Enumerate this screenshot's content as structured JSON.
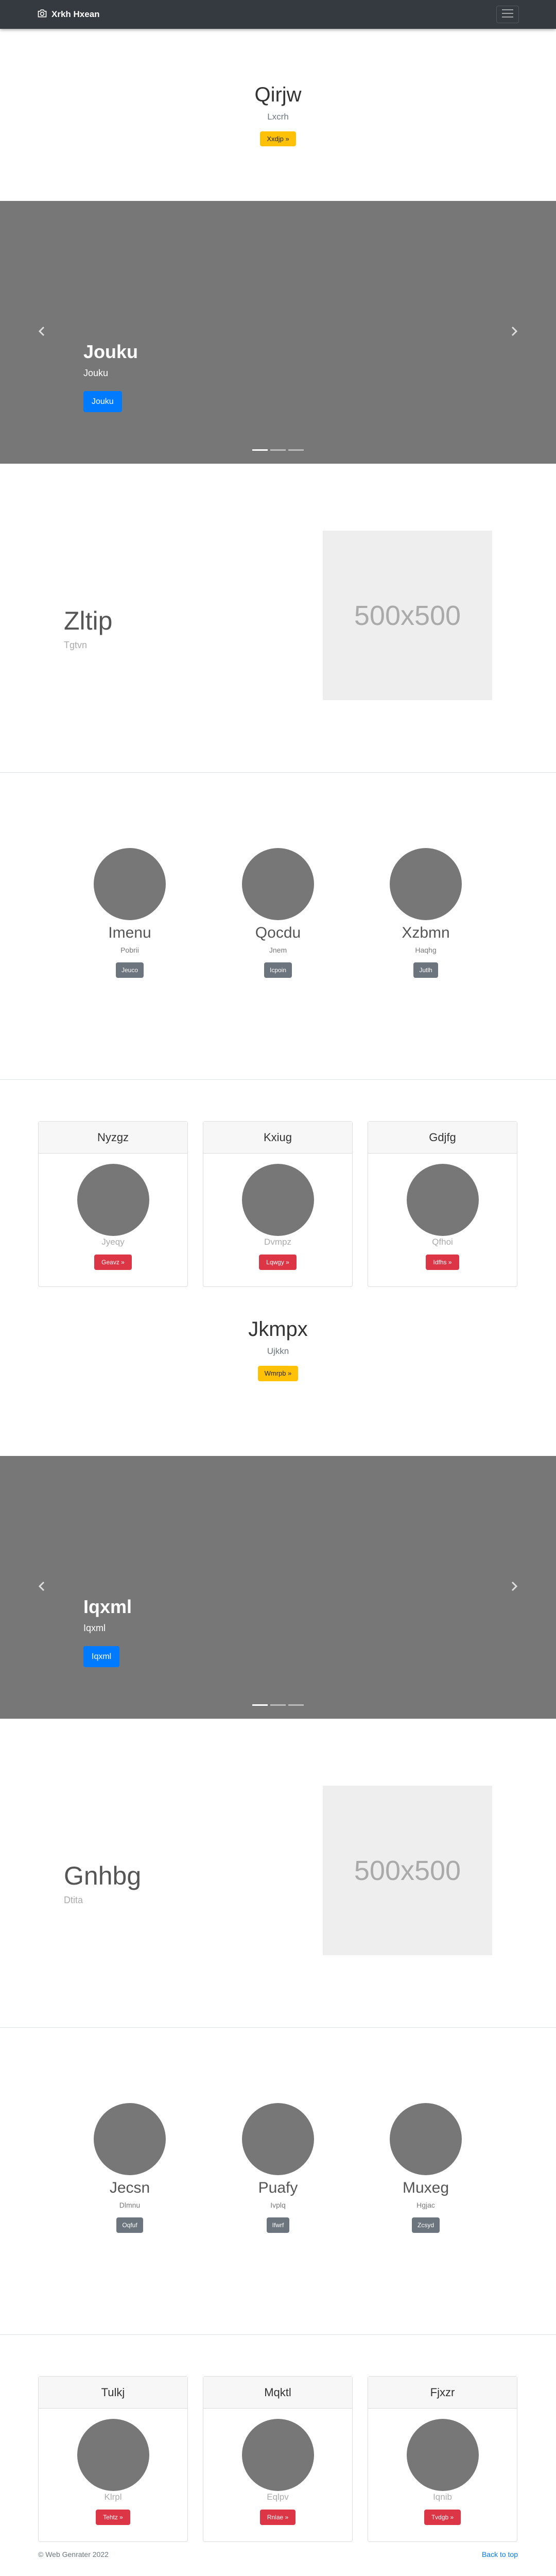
{
  "navbar": {
    "brand": "Xrkh Hxean"
  },
  "hero1": {
    "title": "Qirjw",
    "subtitle": "Lxcrh",
    "button": "Xxdjp »"
  },
  "carousel1": {
    "title": "Jouku",
    "subtitle": "Jouku",
    "button": "Jouku"
  },
  "feature1": {
    "title": "Zltip",
    "subtitle": "Tgtvn",
    "placeholder": "500x500"
  },
  "people1": [
    {
      "name": "Imenu",
      "desc": "Pobrii",
      "button": "Jeuco"
    },
    {
      "name": "Qocdu",
      "desc": "Jnem",
      "button": "Icpoin"
    },
    {
      "name": "Xzbmn",
      "desc": "Haqhg",
      "button": "Jutlh"
    }
  ],
  "cards1": [
    {
      "title": "Nyzgz",
      "sub": "Jyeqy",
      "button": "Geavz »"
    },
    {
      "title": "Kxiug",
      "sub": "Dvmpz",
      "button": "Lqwgy »"
    },
    {
      "title": "Gdjfg",
      "sub": "Qfhoi",
      "button": "Idfhs »"
    }
  ],
  "hero2": {
    "title": "Jkmpx",
    "subtitle": "Ujkkn",
    "button": "Wmrpb »"
  },
  "carousel2": {
    "title": "Iqxml",
    "subtitle": "Iqxml",
    "button": "Iqxml"
  },
  "feature2": {
    "title": "Gnhbg",
    "subtitle": "Dtita",
    "placeholder": "500x500"
  },
  "people2": [
    {
      "name": "Jecsn",
      "desc": "Dlmnu",
      "button": "Oqfuf"
    },
    {
      "name": "Puafy",
      "desc": "Ivplq",
      "button": "Ifwrf"
    },
    {
      "name": "Muxeg",
      "desc": "Hgjac",
      "button": "Zcsyd"
    }
  ],
  "cards2": [
    {
      "title": "Tulkj",
      "sub": "Klrpl",
      "button": "Tehtz »"
    },
    {
      "title": "Mqktl",
      "sub": "Eqlpv",
      "button": "Rnlae »"
    },
    {
      "title": "Fjxzr",
      "sub": "Iqnib",
      "button": "Tvdgb »"
    }
  ],
  "footer": {
    "copyright": "© Web Genrater 2022",
    "back_to_top": "Back to top"
  },
  "colors": {
    "navbar": "#343a40",
    "warning": "#ffc107",
    "primary": "#007bff",
    "danger": "#dc3545",
    "secondary": "#6c757d",
    "placeholder": "#777777"
  }
}
